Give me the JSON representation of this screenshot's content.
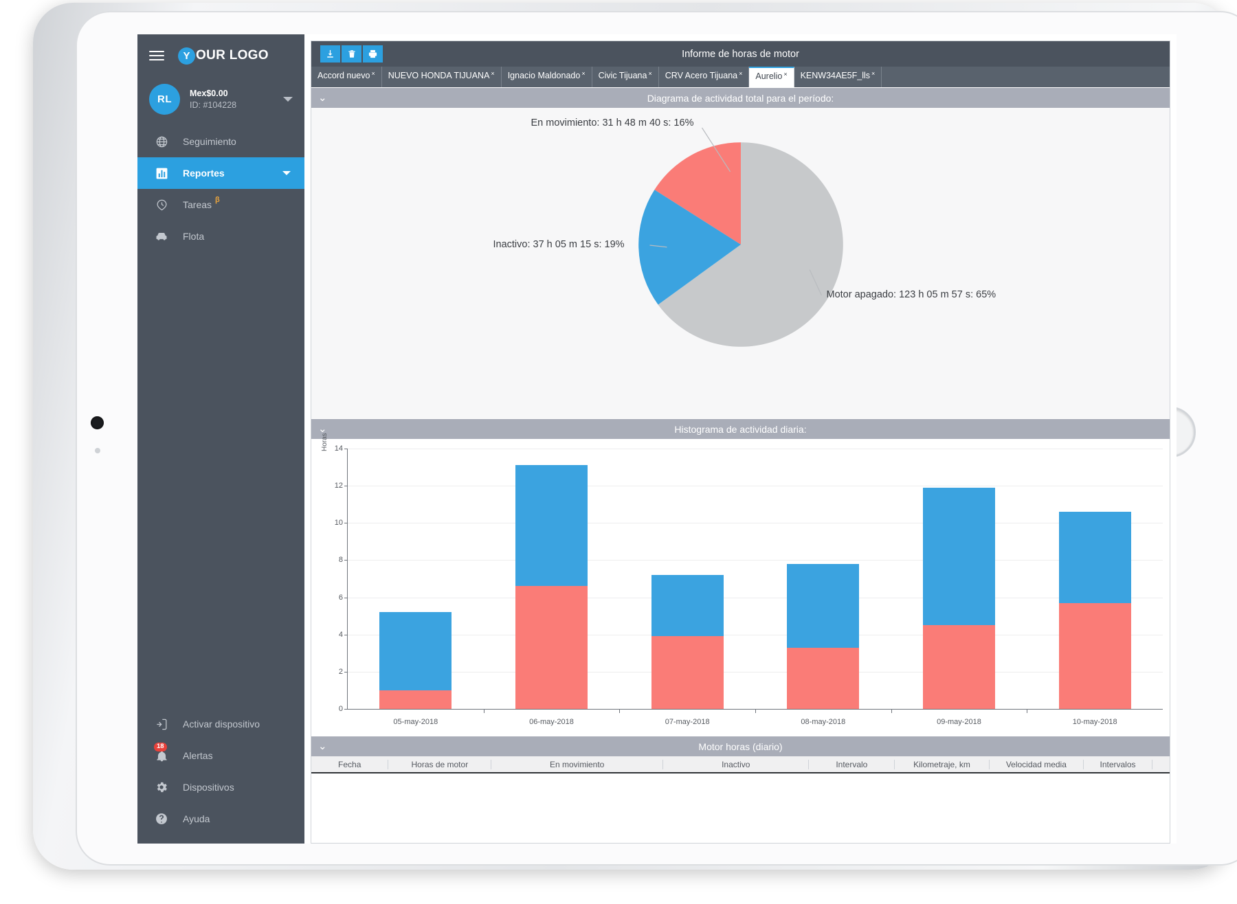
{
  "sidebar": {
    "logo_badge": "Y",
    "logo_text": "OUR LOGO",
    "menu_icon": "hamburger-icon",
    "account": {
      "initials": "RL",
      "balance": "Mex$0.00",
      "id": "ID: #104228"
    },
    "items": [
      {
        "label": "Seguimiento",
        "icon": "globe-icon",
        "active": false,
        "caret": false,
        "beta": false
      },
      {
        "label": "Reportes",
        "icon": "bar-chart-icon",
        "active": true,
        "caret": true,
        "beta": false
      },
      {
        "label": "Tareas",
        "icon": "clock-pin-icon",
        "active": false,
        "caret": false,
        "beta": true,
        "beta_label": "β"
      },
      {
        "label": "Flota",
        "icon": "car-icon",
        "active": false,
        "caret": false,
        "beta": false
      }
    ],
    "bottom_items": [
      {
        "label": "Activar dispositivo",
        "icon": "device-add-icon",
        "badge": ""
      },
      {
        "label": "Alertas",
        "icon": "bell-icon",
        "badge": "18"
      },
      {
        "label": "Dispositivos",
        "icon": "gear-icon",
        "badge": ""
      },
      {
        "label": "Ayuda",
        "icon": "help-circle-icon",
        "badge": ""
      }
    ]
  },
  "window": {
    "title": "Informe de horas de motor",
    "toolbar": [
      {
        "name": "download-button",
        "glyph": "download-icon"
      },
      {
        "name": "delete-button",
        "glyph": "trash-icon"
      },
      {
        "name": "print-button",
        "glyph": "printer-icon"
      }
    ]
  },
  "tabs": [
    {
      "label": "Accord nuevo",
      "active": false,
      "close": "×"
    },
    {
      "label": "NUEVO HONDA TIJUANA",
      "active": false,
      "close": "×"
    },
    {
      "label": "Ignacio Maldonado",
      "active": false,
      "close": "×"
    },
    {
      "label": "Civic Tijuana",
      "active": false,
      "close": "×"
    },
    {
      "label": "CRV Acero Tijuana",
      "active": false,
      "close": "×"
    },
    {
      "label": "Aurelio",
      "active": true,
      "close": "×"
    },
    {
      "label": "KENW34AE5F_lls",
      "active": false,
      "close": "×"
    }
  ],
  "panels": {
    "pie": {
      "title": "Diagrama de actividad total para el período:",
      "chevron": "⌄"
    },
    "histogram": {
      "title": "Histograma de actividad diaria:",
      "chevron": "⌄"
    },
    "table": {
      "title": "Motor horas (diario)",
      "chevron": "⌄"
    }
  },
  "table": {
    "columns": [
      "Fecha",
      "Horas de motor",
      "En movimiento",
      "Inactivo",
      "Intervalo",
      "Kilometraje, km",
      "Velocidad media",
      "Intervalos",
      ""
    ]
  },
  "colors": {
    "accent": "#2ca0e0",
    "sidebar": "#4b535e",
    "moving": "#fa7c77",
    "idle": "#3ba3e0",
    "engine_off": "#c7c9cb",
    "badge": "#e8413a",
    "beta": "#e8a33d"
  },
  "chart_data": [
    {
      "type": "pie",
      "title": "Diagrama de actividad total para el período:",
      "legend_position": "callout-labels",
      "slices": [
        {
          "name": "En movimiento",
          "label": "En movimiento: 31 h 48 m 40 s: 16%",
          "duration": "31 h 48 m 40 s",
          "percent": 16,
          "color": "#fa7c77"
        },
        {
          "name": "Inactivo",
          "label": "Inactivo: 37 h 05 m 15 s: 19%",
          "duration": "37 h 05 m 15 s",
          "percent": 19,
          "color": "#3ba3e0"
        },
        {
          "name": "Motor apagado",
          "label": "Motor apagado: 123 h 05 m 57 s: 65%",
          "duration": "123 h 05 m 57 s",
          "percent": 65,
          "color": "#c7c9cb"
        }
      ]
    },
    {
      "type": "bar",
      "stacked": true,
      "title": "Histograma de actividad diaria:",
      "xlabel": "",
      "ylabel": "Horas",
      "ylim": [
        0,
        14
      ],
      "yticks": [
        0,
        2,
        4,
        6,
        8,
        10,
        12,
        14
      ],
      "grid": true,
      "categories": [
        "05-may-2018",
        "06-may-2018",
        "07-may-2018",
        "08-may-2018",
        "09-may-2018",
        "10-may-2018"
      ],
      "series": [
        {
          "name": "En movimiento",
          "color": "#fa7c77",
          "values": [
            1.0,
            6.6,
            3.9,
            3.3,
            4.5,
            5.7
          ]
        },
        {
          "name": "Inactivo",
          "color": "#3ba3e0",
          "values": [
            4.2,
            6.5,
            3.3,
            4.5,
            7.4,
            4.9
          ]
        }
      ],
      "totals": [
        5.2,
        13.1,
        7.2,
        7.8,
        11.9,
        10.6
      ]
    }
  ]
}
